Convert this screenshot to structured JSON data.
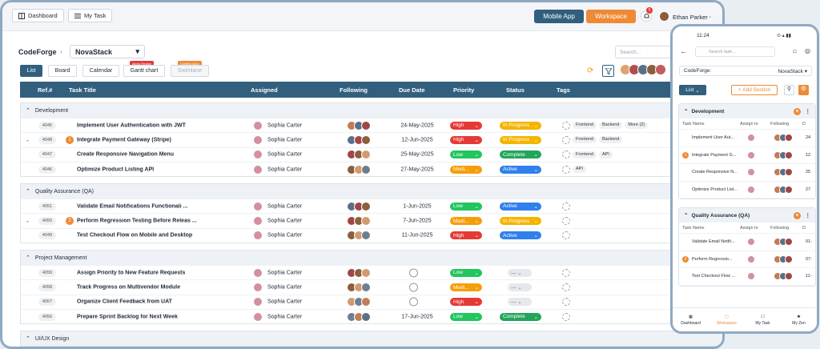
{
  "topbar": {
    "dashboard": "Dashboard",
    "mytask": "My Task",
    "mobile_app": "Mobile App",
    "workspace": "Workspace",
    "notif_count": "5",
    "user": "Ethan Parker"
  },
  "crumb": {
    "org": "CodeForge",
    "project": "NovaStack"
  },
  "search_placeholder": "Search...",
  "views": [
    "List",
    "Board",
    "Calendar",
    "Gantt chart",
    "Swimlane"
  ],
  "view_tags": {
    "gantt": "Alpha Realse",
    "swimlane": "Coming soon"
  },
  "columns": [
    "Ref.#",
    "Task Title",
    "Assigned",
    "Following",
    "Due Date",
    "Priority",
    "Status",
    "Tags"
  ],
  "sections": [
    {
      "name": "Development",
      "rows": [
        {
          "ref": "4045",
          "num": "",
          "title": "Implement User Authentication with JWT",
          "assignee": "Sophia Carter",
          "due": "24-May-2025",
          "priority": "High",
          "status": "In Progress",
          "tags": [
            "Frontend",
            "Backend",
            "More (2)"
          ]
        },
        {
          "ref": "4048",
          "num": "1",
          "title": "Integrate Payment Gateway (Stripe)",
          "assignee": "Sophia Carter",
          "due": "12-Jun-2025",
          "priority": "High",
          "status": "In Progress",
          "tags": [
            "Frontend",
            "Backend"
          ]
        },
        {
          "ref": "4047",
          "num": "",
          "title": "Create Responsive Navigation Menu",
          "assignee": "Sophia Carter",
          "due": "25-May-2025",
          "priority": "Low",
          "status": "Complete",
          "tags": [
            "Frontend",
            "API"
          ]
        },
        {
          "ref": "4046",
          "num": "",
          "title": "Optimize Product Listing API",
          "assignee": "Sophia Carter",
          "due": "27-May-2025",
          "priority": "Medi...",
          "status": "Active",
          "tags": [
            "API"
          ]
        }
      ]
    },
    {
      "name": "Quality Assurance (QA)",
      "rows": [
        {
          "ref": "4051",
          "num": "",
          "title": "Validate Email Notifications Functionali ...",
          "assignee": "Sophia Carter",
          "due": "1-Jun-2025",
          "priority": "Low",
          "status": "Active",
          "tags": []
        },
        {
          "ref": "4050",
          "num": "2",
          "title": "Perform Regression Testing Before Releas ...",
          "assignee": "Sophia Carter",
          "due": "7-Jun-2025",
          "priority": "Medi...",
          "status": "In Progress",
          "tags": []
        },
        {
          "ref": "4049",
          "num": "",
          "title": "Test Checkout Flow on Mobile and Desktop",
          "assignee": "Sophia Carter",
          "due": "11-Jun-2025",
          "priority": "High",
          "status": "Active",
          "tags": []
        }
      ]
    },
    {
      "name": "Project Management",
      "rows": [
        {
          "ref": "4059",
          "num": "",
          "title": "Assign Priority to New Feature Requests",
          "assignee": "Sophia Carter",
          "due": "",
          "priority": "Low",
          "status": "",
          "tags": []
        },
        {
          "ref": "4058",
          "num": "",
          "title": "Track Progress on Multivendor Module",
          "assignee": "Sophia Carter",
          "due": "",
          "priority": "Medi...",
          "status": "",
          "tags": []
        },
        {
          "ref": "4057",
          "num": "",
          "title": "Organize Client Feedback from UAT",
          "assignee": "Sophia Carter",
          "due": "",
          "priority": "High",
          "status": "",
          "tags": []
        },
        {
          "ref": "4056",
          "num": "",
          "title": "Prepare Sprint Backlog for Next Week",
          "assignee": "Sophia Carter",
          "due": "17-Jun-2025",
          "priority": "Low",
          "status": "Complete",
          "tags": []
        }
      ]
    },
    {
      "name": "UI/UX Design",
      "rows": []
    }
  ],
  "colors": {
    "High": "#e53935",
    "Low": "#22c55e",
    "Medi...": "#f59e0b",
    "In Progress": "#f5b400",
    "Complete": "#22a55a",
    "Active": "#2f80ed"
  },
  "phone": {
    "time": "11:24",
    "search_placeholder": "Search task...",
    "project_label": "CodeForge:",
    "project": "NovaStack",
    "list": "List",
    "add_section": "Add Section",
    "col_task": "Task Name",
    "col_assign": "Assign to",
    "col_follow": "Following",
    "sections": [
      {
        "name": "Development",
        "rows": [
          {
            "num": "",
            "title": "Implement User Aut...",
            "d": "24"
          },
          {
            "num": "1",
            "title": "Integrate Payment G...",
            "d": "12"
          },
          {
            "num": "",
            "title": "Create Responsive N...",
            "d": "25"
          },
          {
            "num": "",
            "title": "Optimize Product List...",
            "d": "27"
          }
        ]
      },
      {
        "name": "Quality Assurance (QA)",
        "rows": [
          {
            "num": "",
            "title": "Validate Email Notifi...",
            "d": "01-"
          },
          {
            "num": "2",
            "title": "Perform Regressio...",
            "d": "07-"
          },
          {
            "num": "",
            "title": "Test Checkout Flow ...",
            "d": "11-"
          }
        ]
      }
    ],
    "nav": [
      "Dashboard",
      "Workspace",
      "My Task",
      "My Zen"
    ]
  }
}
